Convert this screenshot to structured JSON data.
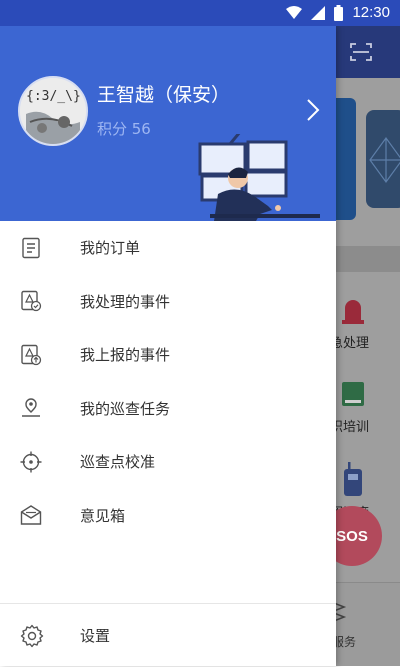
{
  "status_bar": {
    "time": "12:30"
  },
  "user": {
    "name": "王智越（保安）",
    "points": "积分 56"
  },
  "menu": [
    {
      "label": "我的订单",
      "icon": "order-list-icon"
    },
    {
      "label": "我处理的事件",
      "icon": "handled-event-icon"
    },
    {
      "label": "我上报的事件",
      "icon": "reported-event-icon"
    },
    {
      "label": "我的巡查任务",
      "icon": "location-pin-icon"
    },
    {
      "label": "巡查点校准",
      "icon": "crosshair-icon"
    },
    {
      "label": "意见箱",
      "icon": "mailbox-icon"
    }
  ],
  "settings": {
    "label": "设置",
    "icon": "gear-icon"
  },
  "background_app": {
    "items": [
      "急处理",
      "织培训",
      "挥调度"
    ],
    "sos_label": "SOS",
    "bottom_label": "服务"
  },
  "colors": {
    "status_bar": "#2b4bb9",
    "drawer_header": "#3c66d2",
    "text": "#333333"
  }
}
